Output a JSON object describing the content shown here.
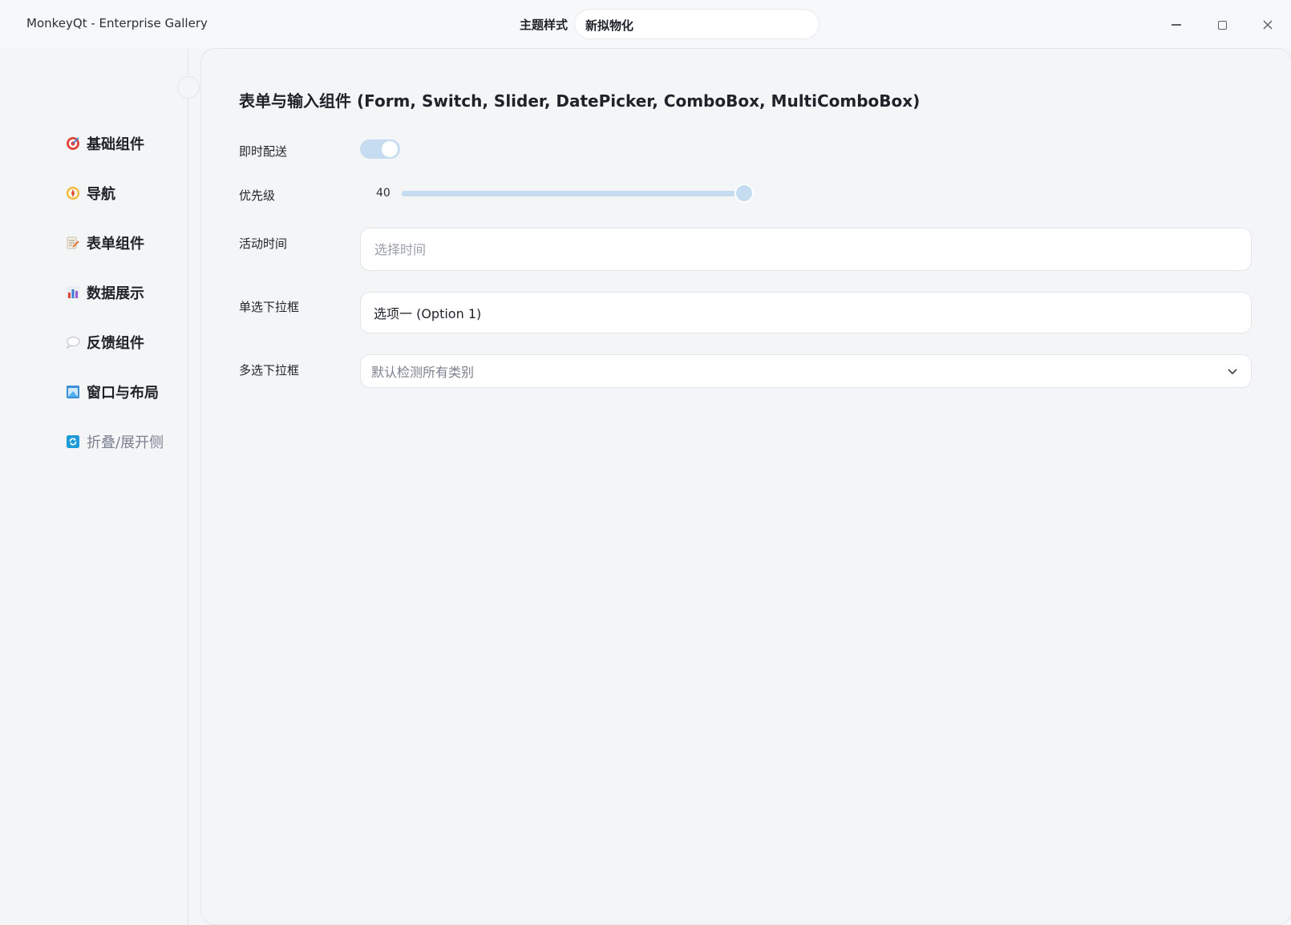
{
  "window": {
    "title": "MonkeyQt - Enterprise Gallery",
    "theme_label": "主题样式",
    "theme_value": "新拟物化"
  },
  "sidebar": {
    "items": [
      {
        "label": "基础组件",
        "icon": "target-icon"
      },
      {
        "label": "导航",
        "icon": "compass-icon"
      },
      {
        "label": "表单组件",
        "icon": "memo-icon"
      },
      {
        "label": "数据展示",
        "icon": "bar-chart-icon"
      },
      {
        "label": "反馈组件",
        "icon": "speech-bubble-icon"
      },
      {
        "label": "窗口与布局",
        "icon": "window-icon"
      },
      {
        "label": "折叠/展开侧",
        "icon": "refresh-icon"
      }
    ]
  },
  "main": {
    "title": "表单与输入组件 (Form, Switch, Slider, DatePicker, ComboBox, MultiComboBox)",
    "switch": {
      "label": "即时配送",
      "on": true
    },
    "slider": {
      "label": "优先级",
      "value": 40,
      "fraction": 0.966
    },
    "datepicker": {
      "label": "活动时间",
      "placeholder": "选择时间"
    },
    "combobox": {
      "label": "单选下拉框",
      "value": "选项一 (Option 1)"
    },
    "multicombobox": {
      "label": "多选下拉框",
      "placeholder": "默认检测所有类别"
    }
  },
  "colors": {
    "accent": "#c5dcf1",
    "background": "#f4f5f7",
    "card": "#ffffff"
  }
}
